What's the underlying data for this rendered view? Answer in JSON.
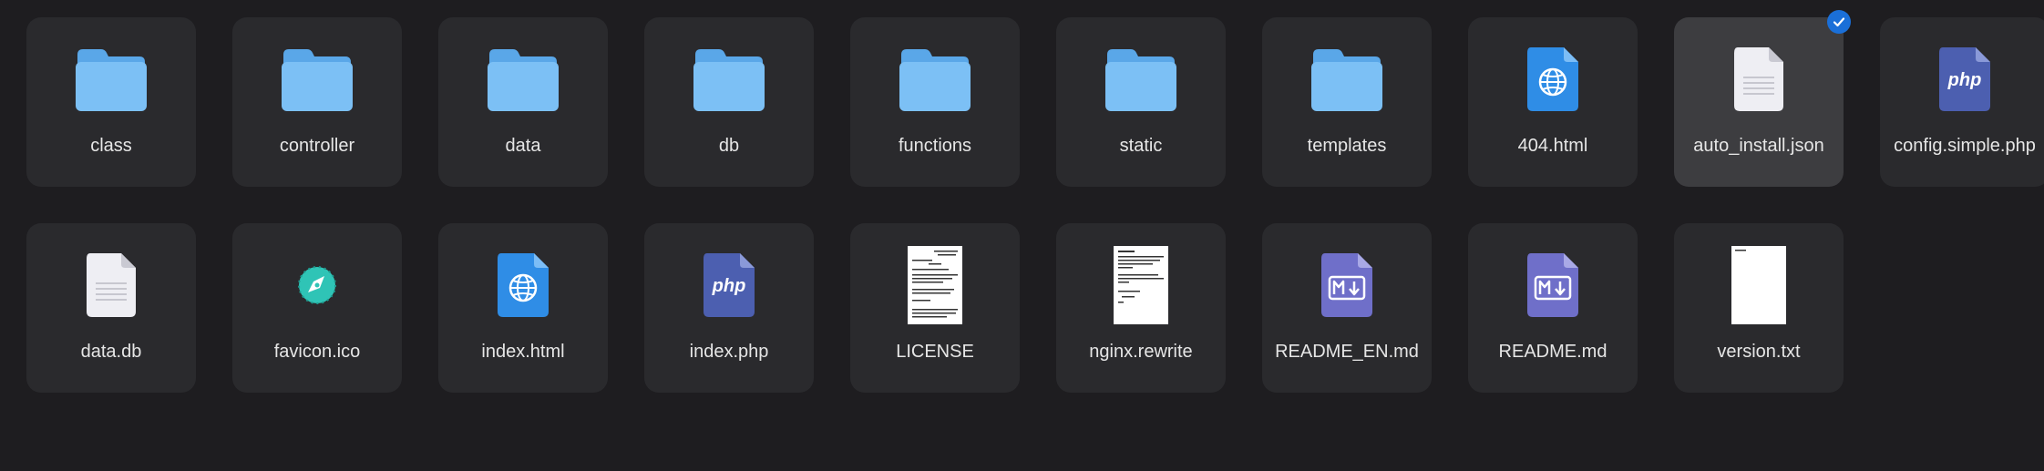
{
  "files": [
    {
      "name": "class",
      "icon": "folder-icon"
    },
    {
      "name": "controller",
      "icon": "folder-icon"
    },
    {
      "name": "data",
      "icon": "folder-icon"
    },
    {
      "name": "db",
      "icon": "folder-icon"
    },
    {
      "name": "functions",
      "icon": "folder-icon"
    },
    {
      "name": "static",
      "icon": "folder-icon"
    },
    {
      "name": "templates",
      "icon": "folder-icon"
    },
    {
      "name": "404.html",
      "icon": "html-file-icon"
    },
    {
      "name": "auto_install.json",
      "icon": "generic-file-icon",
      "selected": true
    },
    {
      "name": "config.simple.php",
      "icon": "php-file-icon"
    },
    {
      "name": "data.db",
      "icon": "generic-file-icon"
    },
    {
      "name": "favicon.ico",
      "icon": "compass-icon"
    },
    {
      "name": "index.html",
      "icon": "html-file-icon"
    },
    {
      "name": "index.php",
      "icon": "php-file-icon"
    },
    {
      "name": "LICENSE",
      "icon": "text-preview-icon"
    },
    {
      "name": "nginx.rewrite",
      "icon": "text-preview-icon"
    },
    {
      "name": "README_EN.md",
      "icon": "markdown-file-icon"
    },
    {
      "name": "README.md",
      "icon": "markdown-file-icon"
    },
    {
      "name": "version.txt",
      "icon": "blank-page-icon"
    }
  ],
  "php_badge": "php",
  "colors": {
    "background": "#1e1d20",
    "tile": "#2a2a2d",
    "tile_selected": "#3d3d40",
    "folder": "#6cb6f2",
    "html_icon": "#2f8de6",
    "php_icon": "#4c5fb0",
    "markdown_icon": "#6f6fc9",
    "compass": "#2fc4b6",
    "check_badge": "#1a6fd8"
  }
}
